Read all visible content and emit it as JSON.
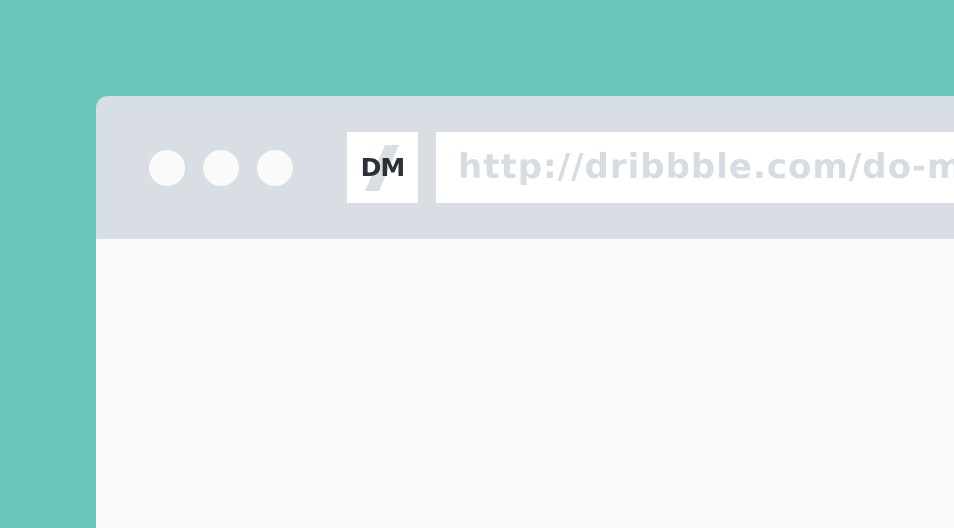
{
  "colors": {
    "background": "#67c6b9",
    "toolbar": "#d8dee4",
    "content": "#fafafa",
    "window_dot": "#fbfafa",
    "logo_bg": "#ffffff",
    "logo_text": "#2a3238",
    "logo_slash": "#d8dee4",
    "address_bg": "#ffffff",
    "url_text": "#d5dce2"
  },
  "toolbar": {
    "window_controls": [
      "circle",
      "circle",
      "circle"
    ],
    "logo": {
      "text": "DM",
      "icon": "dm-logo-icon"
    },
    "address_bar": {
      "value": "http://dribbble.com/do-m"
    }
  }
}
